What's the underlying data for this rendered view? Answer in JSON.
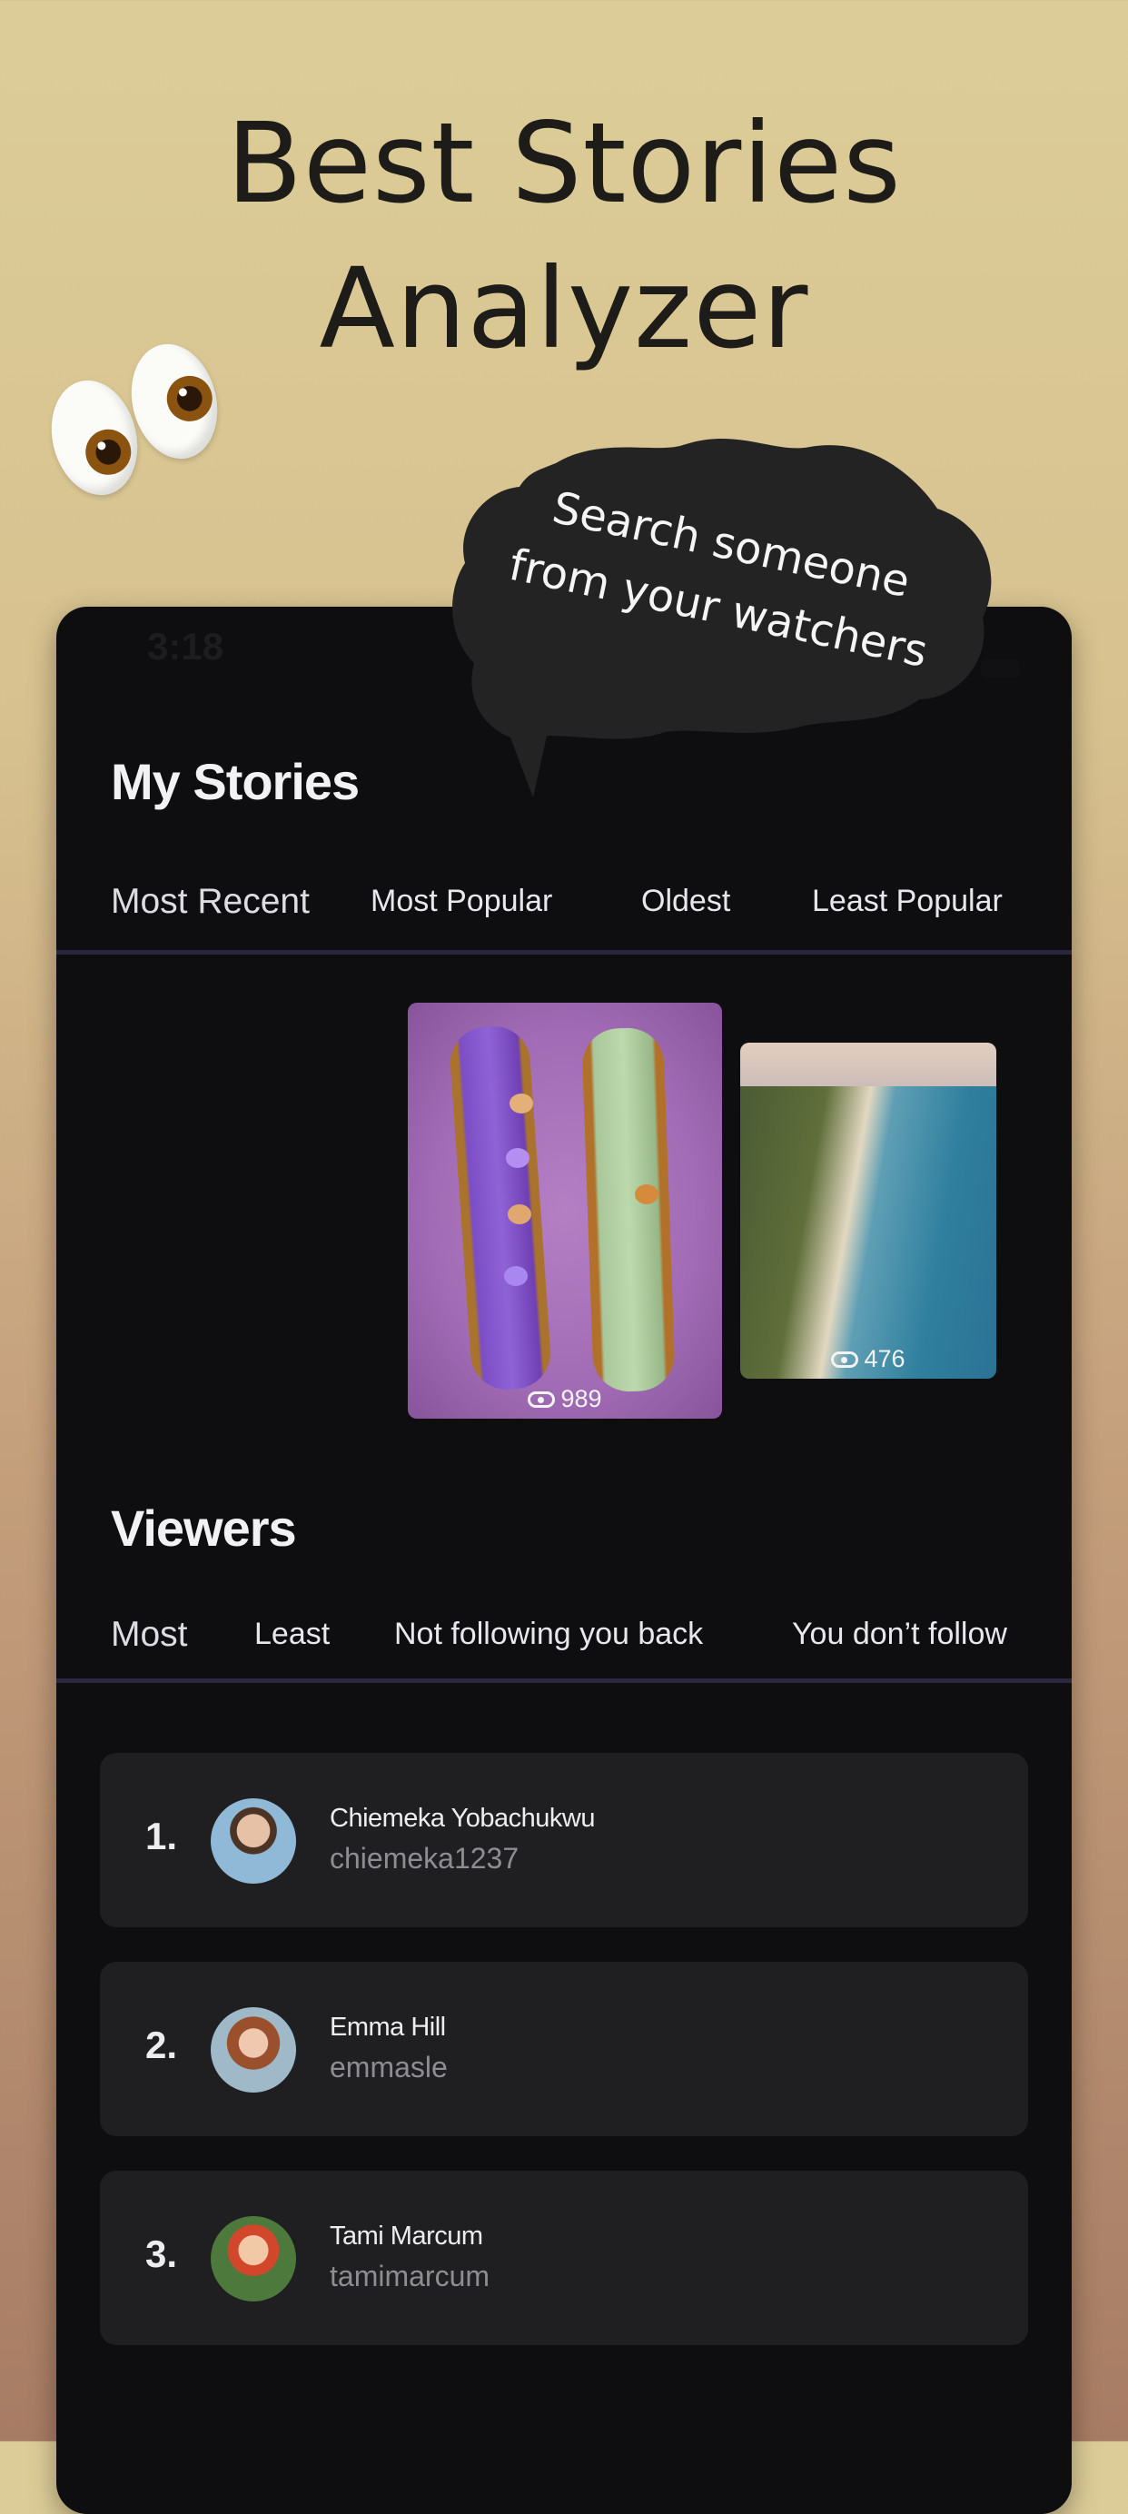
{
  "headline": {
    "line1": "Best Stories",
    "line2": "Analyzer"
  },
  "callout": {
    "line1": "Search someone",
    "line2": "from your watchers"
  },
  "status_bar": {
    "time": "3:18"
  },
  "my_stories": {
    "title": "My Stories",
    "tabs": [
      "Most Recent",
      "Most Popular",
      "Oldest",
      "Least Popular"
    ],
    "active_tab": "Most Recent",
    "stories": [
      {
        "views": "989"
      },
      {
        "views": "476"
      }
    ]
  },
  "viewers": {
    "title": "Viewers",
    "tabs": [
      "Most",
      "Least",
      "Not following you back",
      "You don’t follow"
    ],
    "active_tab": "Most",
    "list": [
      {
        "rank": "1.",
        "name": "Chiemeka Yobachukwu",
        "handle": "chiemeka1237"
      },
      {
        "rank": "2.",
        "name": "Emma Hill",
        "handle": "emmasle"
      },
      {
        "rank": "3.",
        "name": "Tami Marcum",
        "handle": "tamimarcum"
      }
    ]
  },
  "colors": {
    "phone_bg": "#0e0e10",
    "card_bg": "#1f1f21",
    "tab_divider": "#2a2640",
    "accent_text": "#ededf0"
  }
}
